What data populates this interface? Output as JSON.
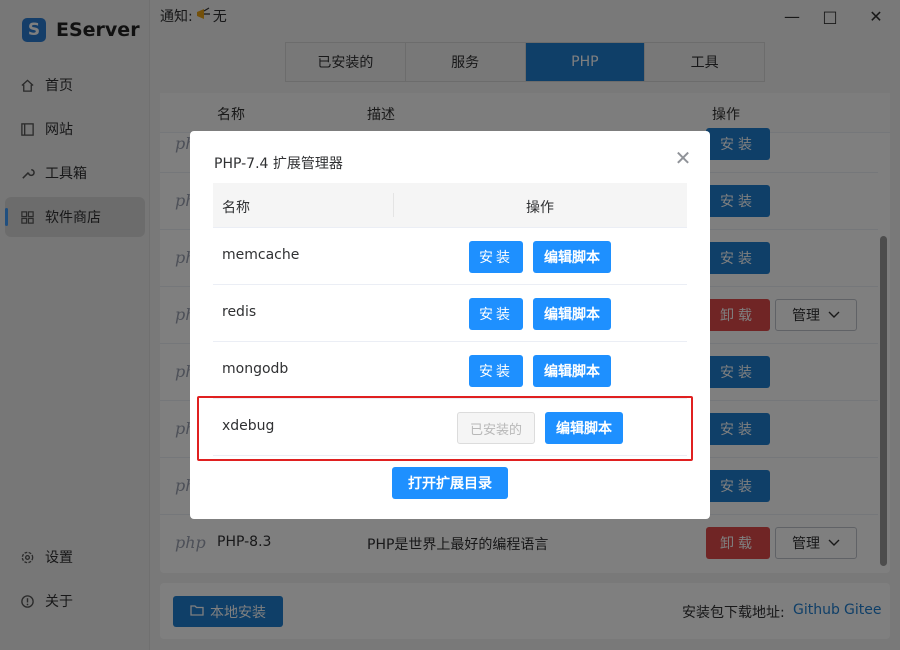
{
  "app": {
    "name": "EServer",
    "logo_letter": "S"
  },
  "notice": {
    "label": "通知:",
    "value": "无"
  },
  "window_controls": {
    "minimize": "—",
    "maximize": "□",
    "close": "✕"
  },
  "sidebar": {
    "items": [
      {
        "label": "首页",
        "icon": "home-icon"
      },
      {
        "label": "网站",
        "icon": "website-icon"
      },
      {
        "label": "工具箱",
        "icon": "wrench-icon"
      },
      {
        "label": "软件商店",
        "icon": "grid-icon",
        "active": true
      },
      {
        "label": "设置",
        "icon": "gear-icon"
      },
      {
        "label": "关于",
        "icon": "info-icon"
      }
    ]
  },
  "tabs": [
    {
      "label": "已安装的"
    },
    {
      "label": "服务"
    },
    {
      "label": "PHP",
      "active": true
    },
    {
      "label": "工具"
    }
  ],
  "main_table": {
    "columns": [
      "名称",
      "描述",
      "操作"
    ],
    "rows": [
      {
        "logo": "php",
        "action": "安装"
      },
      {
        "logo": "php",
        "action": "安装"
      },
      {
        "logo": "php",
        "action": "安装"
      },
      {
        "logo": "php",
        "action": "卸载",
        "manage": "管理"
      },
      {
        "logo": "php",
        "action": "安装"
      },
      {
        "logo": "php",
        "action": "安装"
      },
      {
        "logo": "php",
        "action": "安装"
      },
      {
        "logo": "php",
        "name": "PHP-8.3",
        "desc": "PHP是世界上最好的编程语言",
        "action": "卸载",
        "manage": "管理"
      }
    ]
  },
  "bottom": {
    "local_install": "本地安装",
    "download_label": "安装包下载地址:",
    "links": [
      "Github",
      "Gitee"
    ]
  },
  "dialog": {
    "title": "PHP-7.4 扩展管理器",
    "columns": {
      "name": "名称",
      "op": "操作"
    },
    "rows": [
      {
        "name": "memcache",
        "install": "安装",
        "edit": "编辑脚本"
      },
      {
        "name": "redis",
        "install": "安装",
        "edit": "编辑脚本"
      },
      {
        "name": "mongodb",
        "install": "安装",
        "edit": "编辑脚本"
      },
      {
        "name": "xdebug",
        "installed": "已安装的",
        "edit": "编辑脚本"
      }
    ],
    "open_dir": "打开扩展目录",
    "close": "✕"
  },
  "colors": {
    "accent": "#1f7ed0",
    "button_blue": "#1e90ff",
    "danger": "#e04a4a",
    "highlight": "#e02020"
  }
}
